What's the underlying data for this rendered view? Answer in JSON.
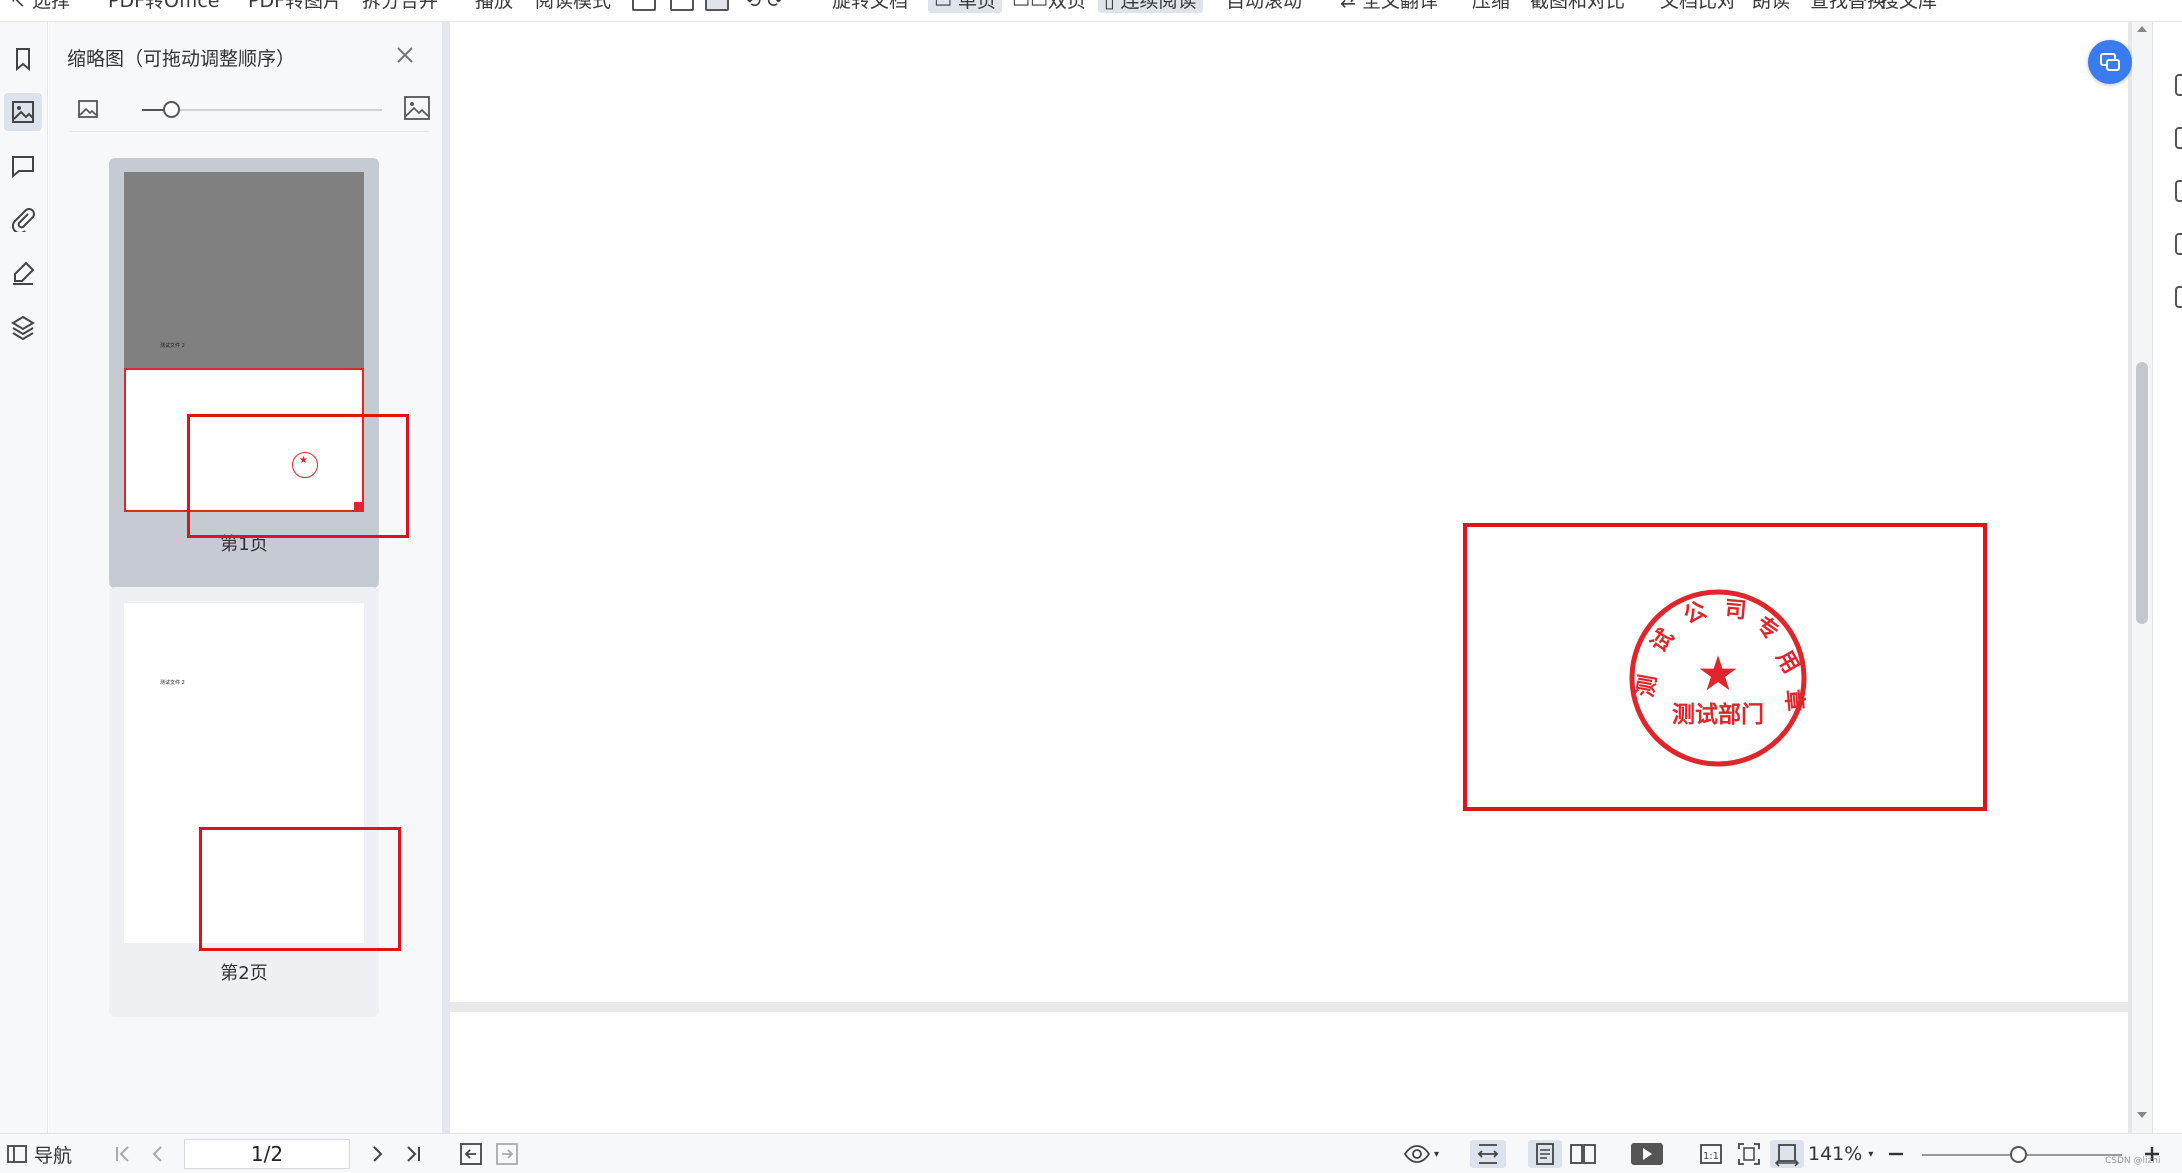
{
  "toolbar": {
    "items": [
      "选择",
      "PDF转Office",
      "PDF转图片",
      "拆分合并",
      "播放",
      "阅读模式",
      "旋转文档",
      "单页",
      "双页",
      "连续阅读",
      "自动滚动",
      "全文翻译",
      "压缩",
      "截图和对比",
      "文档比对",
      "朗读",
      "查找替换",
      "搜文库"
    ]
  },
  "sidebar": {
    "rail": [
      "bookmark-icon",
      "thumbnail-icon",
      "comment-icon",
      "attachment-icon",
      "signature-icon",
      "layers-icon"
    ],
    "active_rail": "thumbnail-icon"
  },
  "thumbnail_panel": {
    "title": "缩略图（可拖动调整顺序）",
    "size_slider": 0.12,
    "pages": [
      {
        "label": "第1页",
        "text": "测试文件 2",
        "selected": true
      },
      {
        "label": "第2页",
        "text": "测试文件 2",
        "selected": false
      }
    ]
  },
  "document": {
    "seal": {
      "arc_text": [
        "测",
        "试",
        "公",
        "司",
        "专",
        "用",
        "章"
      ],
      "center_text": "测试部门",
      "color": "#e0262b"
    }
  },
  "statusbar": {
    "nav_label": "导航",
    "page_indicator": "1/2",
    "zoom_label": "141%",
    "zoom_slider": 0.48
  },
  "watermark": "CSDN @lizhi",
  "colors": {
    "annotation_red": "#e0121a",
    "accent_blue": "#3a7bf0"
  }
}
